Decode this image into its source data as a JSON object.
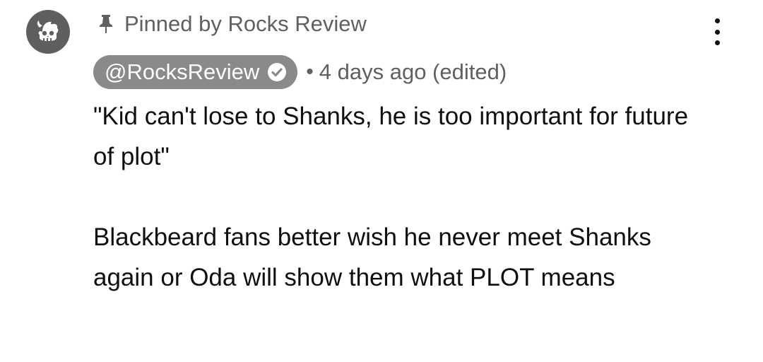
{
  "comment": {
    "pinned_label": "Pinned by Rocks Review",
    "author": "@RocksReview",
    "separator": "•",
    "timestamp": "4 days ago (edited)",
    "paragraphs": [
      "\"Kid can't lose to Shanks, he is too important for future of plot\"",
      "Blackbeard fans better wish he never meet Shanks again or Oda will show them what PLOT means"
    ]
  },
  "icons": {
    "avatar": "skull-avatar-icon",
    "pin": "pin-icon",
    "verified": "verified-check-icon",
    "more": "more-vert-icon"
  },
  "colors": {
    "author_chip": "#8a8a8a",
    "secondary_text": "#606060",
    "avatar_bg": "#5f5f5f"
  }
}
